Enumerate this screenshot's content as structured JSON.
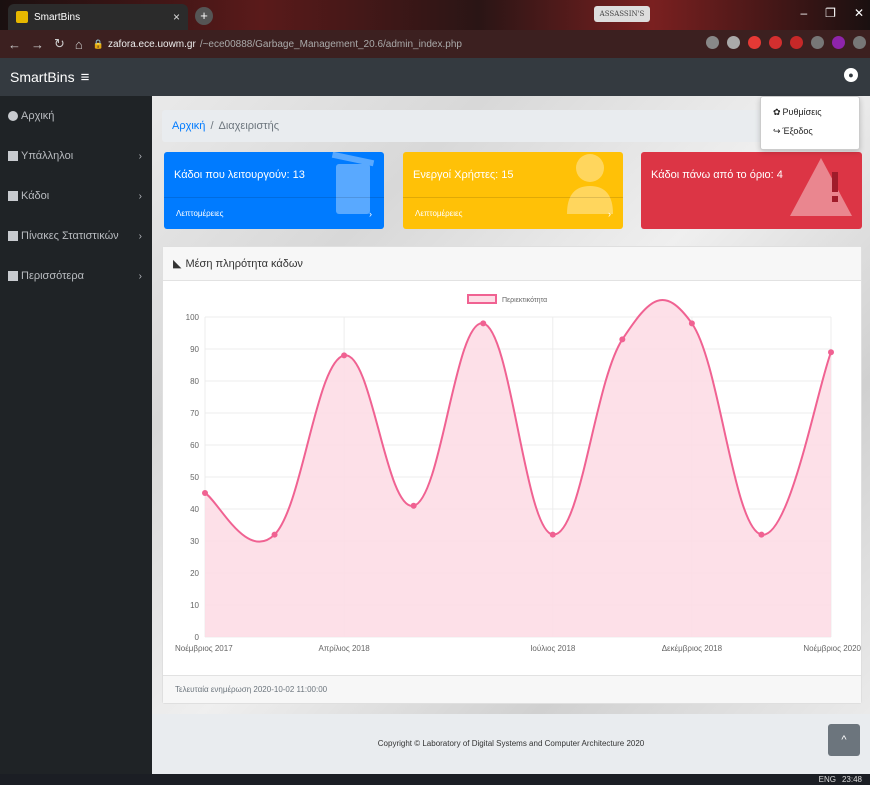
{
  "browser": {
    "tab_title": "SmartBins",
    "tab_close": "×",
    "new_tab": "+",
    "logo_text": "ASSASSIN'S",
    "url_host": "zafora.ece.uowm.gr",
    "url_path": "/~ece00888/Garbage_Management_20.6/admin_index.php"
  },
  "navbar": {
    "brand": "SmartBins",
    "menu_icon": "≡"
  },
  "sidebar": {
    "items": [
      {
        "label": "Αρχική",
        "icon": "dashboard-icon",
        "has_chevron": false
      },
      {
        "label": "Υπάλληλοι",
        "icon": "employees-icon",
        "has_chevron": true
      },
      {
        "label": "Κάδοι",
        "icon": "bin-icon",
        "has_chevron": true
      },
      {
        "label": "Πίνακες Στατιστικών",
        "icon": "chart-icon",
        "has_chevron": true
      },
      {
        "label": "Περισσότερα",
        "icon": "more-icon",
        "has_chevron": true
      }
    ]
  },
  "breadcrumb": {
    "home": "Αρχική",
    "separator": "/",
    "current": "Διαχειριστής"
  },
  "cards": [
    {
      "text": "Κάδοι που λειτουργούν: 13",
      "footer": "Λεπτομέρειες",
      "color": "#007bff",
      "icon": "trash-icon"
    },
    {
      "text": "Ενεργοί Χρήστες: 15",
      "footer": "Λεπτομέρειες",
      "color": "#ffc107",
      "icon": "user-icon"
    },
    {
      "text": "Κάδοι πάνω από το όριο: 4",
      "footer": "",
      "color": "#dc3545",
      "icon": "warning-icon"
    }
  ],
  "chart_card": {
    "title": "Μέση πληρότητα κάδων",
    "footer": "Τελευταία ενημέρωση 2020-10-02 11:00:00"
  },
  "chart_data": {
    "type": "area",
    "legend": [
      "Περιεκτικότητα"
    ],
    "legend_position": "top",
    "x_tick_labels": [
      "Νοέμβριος 2017",
      "Απρίλιος 2018",
      "Ιούλιος 2018",
      "Δεκέμβριος 2018",
      "Νοέμβριος 2020"
    ],
    "y_ticks": [
      0,
      10,
      20,
      30,
      40,
      50,
      60,
      70,
      80,
      90,
      100
    ],
    "ylim": [
      0,
      100
    ],
    "series": [
      {
        "name": "Περιεκτικότητα",
        "values": [
          45,
          32,
          88,
          41,
          98,
          32,
          93,
          98,
          32,
          89
        ]
      }
    ],
    "line_color": "#f06292",
    "fill_color": "#fddde6",
    "grid": true
  },
  "dropdown": {
    "items": [
      {
        "label": "Ρυθμίσεις",
        "icon": "gear-icon"
      },
      {
        "label": "Έξοδος",
        "icon": "logout-icon"
      }
    ]
  },
  "footer": {
    "copyright": "Copyright © Laboratory of Digital Systems and Computer Architecture 2020",
    "to_top": "^"
  },
  "taskbar": {
    "lang": "ENG",
    "time": "23:48"
  }
}
